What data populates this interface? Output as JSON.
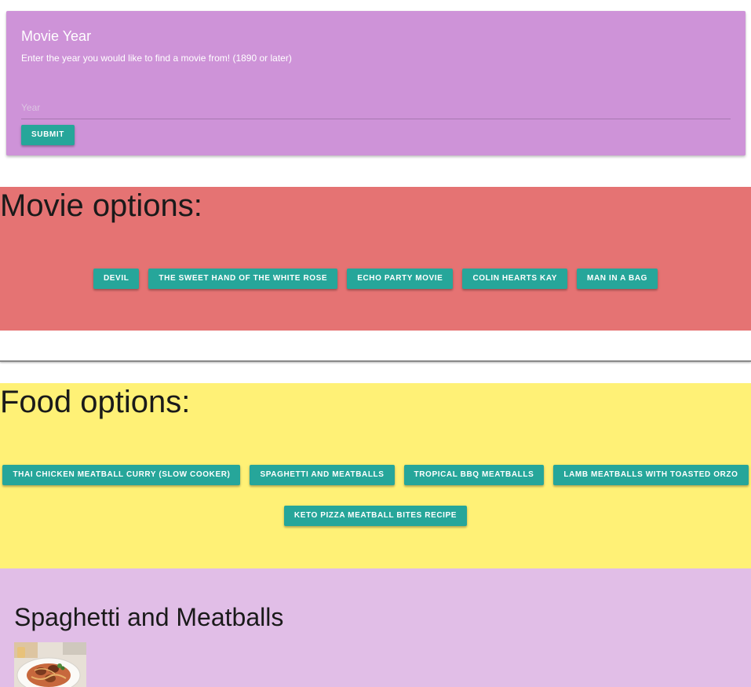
{
  "movie_year_card": {
    "title": "Movie Year",
    "description": "Enter the year you would like to find a movie from! (1890 or later)",
    "year_input": {
      "placeholder": "Year",
      "value": ""
    },
    "submit_label": "SUBMIT"
  },
  "movie_section": {
    "heading": "Movie options:",
    "options": [
      "DEVIL",
      "THE SWEET HAND OF THE WHITE ROSE",
      "ECHO PARTY MOVIE",
      "COLIN HEARTS KAY",
      "MAN IN A BAG"
    ]
  },
  "food_section": {
    "heading": "Food options:",
    "options": [
      "THAI CHICKEN MEATBALL CURRY (SLOW COOKER)",
      "SPAGHETTI AND MEATBALLS",
      "TROPICAL BBQ MEATBALLS",
      "LAMB MEATBALLS WITH TOASTED ORZO",
      "KETO PIZZA MEATBALL BITES RECIPE"
    ]
  },
  "detail_section": {
    "title": "Spaghetti and Meatballs",
    "image_icon": "food-photo"
  },
  "colors": {
    "card_background": "#ce93d8",
    "movie_section": "#e57373",
    "food_section": "#fff176",
    "detail_section": "#e1bee7",
    "button": "#26a69a"
  }
}
